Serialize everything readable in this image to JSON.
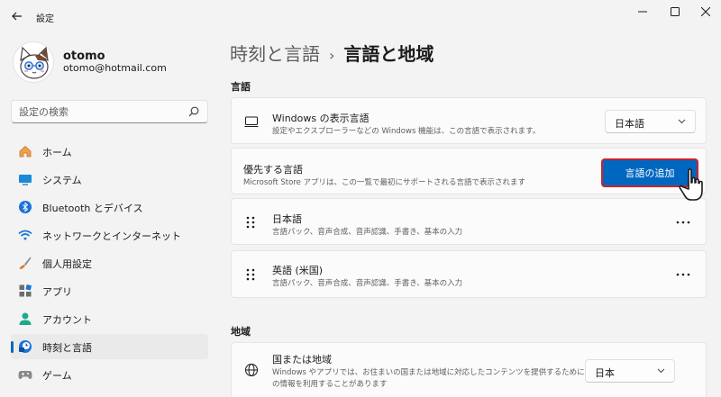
{
  "app": {
    "title": "設定"
  },
  "user": {
    "name": "otomo",
    "email": "otomo@hotmail.com"
  },
  "search": {
    "placeholder": "設定の検索"
  },
  "sidebar": {
    "items": [
      {
        "label": "ホーム",
        "icon": "home-icon"
      },
      {
        "label": "システム",
        "icon": "system-icon"
      },
      {
        "label": "Bluetooth とデバイス",
        "icon": "bluetooth-icon"
      },
      {
        "label": "ネットワークとインターネット",
        "icon": "wifi-icon"
      },
      {
        "label": "個人用設定",
        "icon": "paintbrush-icon"
      },
      {
        "label": "アプリ",
        "icon": "apps-icon"
      },
      {
        "label": "アカウント",
        "icon": "account-icon"
      },
      {
        "label": "時刻と言語",
        "icon": "time-language-icon"
      },
      {
        "label": "ゲーム",
        "icon": "gaming-icon"
      }
    ],
    "selected": "時刻と言語"
  },
  "breadcrumb": {
    "parent": "時刻と言語",
    "separator": "›",
    "current": "言語と地域"
  },
  "language_section": {
    "title": "言語",
    "display_language": {
      "title": "Windows の表示言語",
      "description": "設定やエクスプローラーなどの Windows 機能は、この言語で表示されます。",
      "value": "日本語"
    },
    "preferred": {
      "title": "優先する言語",
      "description": "Microsoft Store アプリは、この一覧で最初にサポートされる言語で表示されます",
      "add_button": "言語の追加"
    },
    "languages": [
      {
        "name": "日本語",
        "features": "言語パック、音声合成、音声認識、手書き、基本の入力"
      },
      {
        "name": "英語 (米国)",
        "features": "言語パック、音声合成、音声認識、手書き、基本の入力"
      }
    ]
  },
  "region_section": {
    "title": "地域",
    "country": {
      "title": "国または地域",
      "description_line1": "Windows やアプリでは、お住まいの国または地域に対応したコンテンツを提供するために、こ",
      "description_line2": "の情報を利用することがあります",
      "value": "日本"
    }
  },
  "colors": {
    "accent": "#0067c0",
    "highlight_border": "#c8242b",
    "background": "#f3f3f3",
    "card": "#fbfbfb"
  }
}
